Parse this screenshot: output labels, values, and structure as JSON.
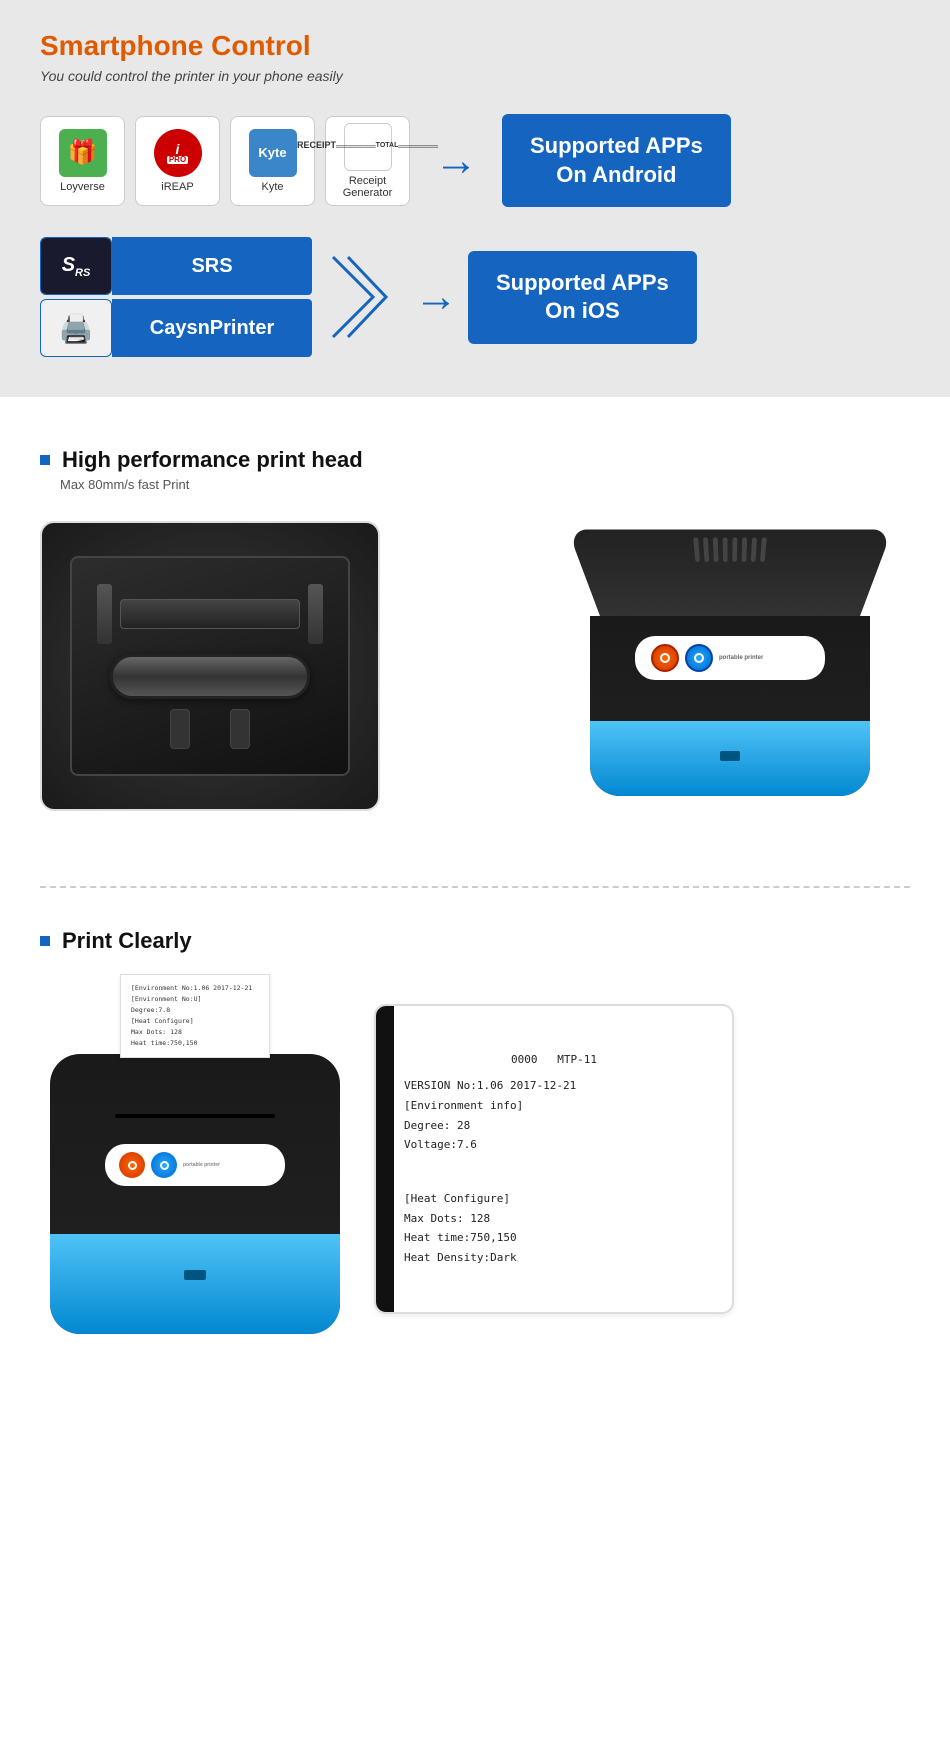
{
  "smartphone": {
    "title": "Smartphone Control",
    "subtitle": "You could control the printer in your phone easily",
    "android_apps": [
      {
        "name": "Loyverse",
        "icon": "🎁",
        "bg": "#4CAF50"
      },
      {
        "name": "iREAP",
        "icon": "i",
        "bg": "#cc0000"
      },
      {
        "name": "Kyte",
        "icon": "Kyte",
        "bg": "#3a86c8"
      },
      {
        "name": "Receipt\nGenerator",
        "icon": "📄",
        "bg": "#f5f5f5"
      }
    ],
    "android_badge_line1": "Supported APPs",
    "android_badge_line2": "On Android",
    "ios_apps": [
      {
        "name": "SRS",
        "icon": "SRS"
      },
      {
        "name": "CaysnPrinter",
        "icon": "🖨"
      }
    ],
    "ios_badge_line1": "Supported APPs",
    "ios_badge_line2": "On iOS"
  },
  "features": [
    {
      "title": "High performance print head",
      "subtitle": "Max 80mm/s fast Print"
    },
    {
      "title": "Print Clearly",
      "subtitle": ""
    }
  ],
  "receipt": {
    "line1": "VERSION No:1.06 2017-12-21",
    "line2": "  0000      MTP-11",
    "line3": "[Environment info]",
    "line4": "Degree: 28",
    "line5": "Voltage:7.6",
    "line6": "",
    "line7": "[Heat Configure]",
    "line8": "Max Dots: 128",
    "line9": "Heat time:750,150",
    "line10": "Heat Density:Dark"
  }
}
